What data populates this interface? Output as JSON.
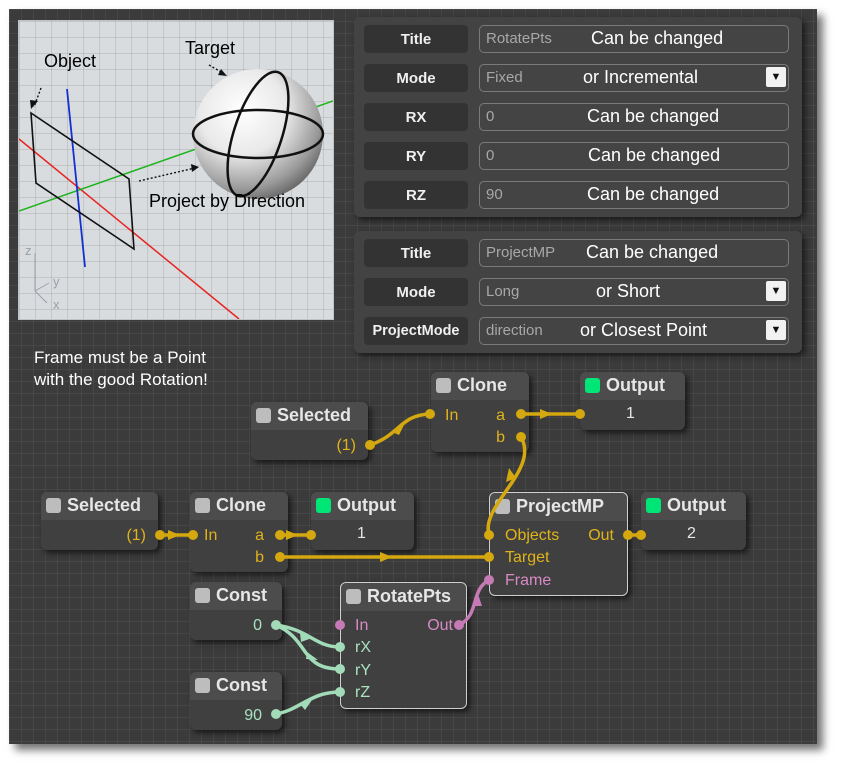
{
  "viewport": {
    "object_label": "Object",
    "target_label": "Target",
    "project_label": "Project by Direction",
    "axis_z": "z",
    "axis_y": "y",
    "axis_x": "x"
  },
  "panels": [
    {
      "rows": [
        {
          "label": "Title",
          "value": "RotatePts",
          "note": "Can be changed",
          "dropdown": false
        },
        {
          "label": "Mode",
          "value": "Fixed",
          "note": "or Incremental",
          "dropdown": true
        },
        {
          "label": "RX",
          "value": "0",
          "note": "Can be changed",
          "dropdown": false
        },
        {
          "label": "RY",
          "value": "0",
          "note": "Can be changed",
          "dropdown": false
        },
        {
          "label": "RZ",
          "value": "90",
          "note": "Can be changed",
          "dropdown": false
        }
      ]
    },
    {
      "rows": [
        {
          "label": "Title",
          "value": "ProjectMP",
          "note": "Can be changed",
          "dropdown": false
        },
        {
          "label": "Mode",
          "value": "Long",
          "note": "or Short",
          "dropdown": true
        },
        {
          "label": "ProjectMode",
          "value": "direction",
          "note": "or Closest Point",
          "dropdown": true
        }
      ]
    }
  ],
  "note": "Frame must be a Point\nwith the good Rotation!",
  "nodes": {
    "selected_top": {
      "title": "Selected",
      "value": "(1)"
    },
    "clone_top": {
      "title": "Clone",
      "in": "In",
      "a": "a",
      "b": "b"
    },
    "output_top": {
      "title": "Output",
      "value": "1"
    },
    "selected_left": {
      "title": "Selected",
      "value": "(1)"
    },
    "clone_left": {
      "title": "Clone",
      "in": "In",
      "a": "a",
      "b": "b"
    },
    "output_left": {
      "title": "Output",
      "value": "1"
    },
    "projectmp": {
      "title": "ProjectMP",
      "objects": "Objects",
      "target": "Target",
      "frame": "Frame",
      "out": "Out"
    },
    "output_right": {
      "title": "Output",
      "value": "2"
    },
    "const_top": {
      "title": "Const",
      "value": "0"
    },
    "const_bottom": {
      "title": "Const",
      "value": "90"
    },
    "rotatepts": {
      "title": "RotatePts",
      "in": "In",
      "rx": "rX",
      "ry": "rY",
      "rz": "rZ",
      "out": "Out"
    }
  },
  "colors": {
    "object_wire": "#d4a80e",
    "number_wire": "#a2dbb8",
    "frame_wire": "#c57ab5",
    "output_active": "#00e676"
  }
}
